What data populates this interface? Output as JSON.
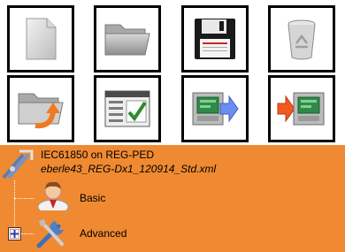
{
  "toolbar": {
    "buttons": [
      {
        "name": "new-file-button",
        "icon": "new-document-icon"
      },
      {
        "name": "open-folder-button",
        "icon": "folder-icon"
      },
      {
        "name": "save-button",
        "icon": "floppy-disk-icon"
      },
      {
        "name": "delete-button",
        "icon": "recycle-bin-icon"
      },
      {
        "name": "open-recent-button",
        "icon": "folder-arrow-icon"
      },
      {
        "name": "settings-check-button",
        "icon": "checklist-window-icon"
      },
      {
        "name": "send-to-device-button",
        "icon": "device-arrow-right-icon"
      },
      {
        "name": "receive-from-device-button",
        "icon": "arrow-into-device-icon"
      }
    ]
  },
  "tree": {
    "project_title": "IEC61850 on REG-PED",
    "project_file": "eberle43_REG-Dx1_120914_Std.xml",
    "nodes": [
      {
        "label": "Basic",
        "icon": "user-icon",
        "expander": null
      },
      {
        "label": "Advanced",
        "icon": "tools-icon",
        "expander": "+"
      }
    ]
  },
  "colors": {
    "panel_bg": "#f08a32",
    "arrow_blue": "#6a8ff0",
    "arrow_orange": "#f05a22"
  }
}
